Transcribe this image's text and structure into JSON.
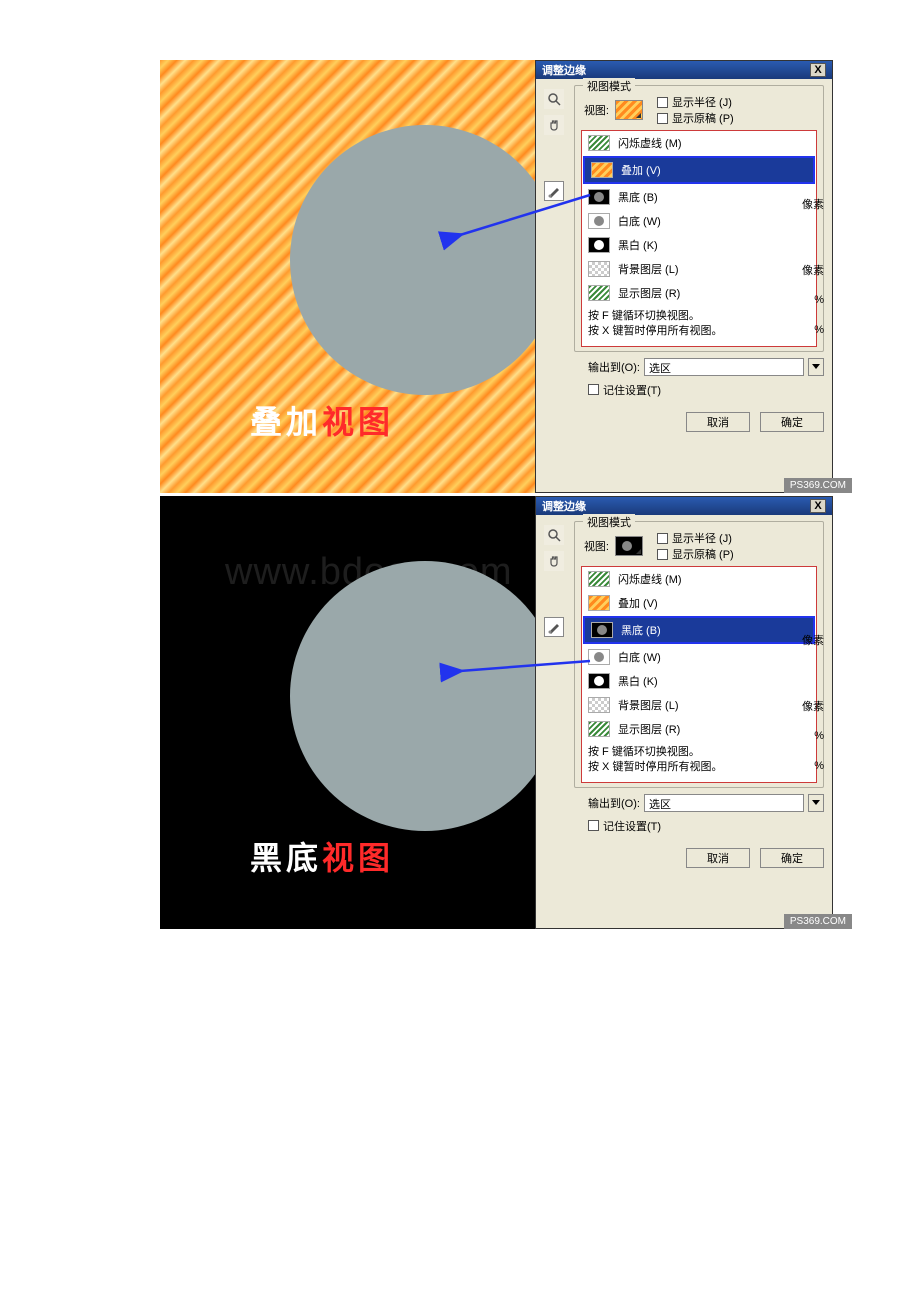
{
  "dialog_title": "调整边缘",
  "close_x": "X",
  "group_title": "视图模式",
  "view_label": "视图:",
  "checkboxes": {
    "show_radius": "显示半径 (J)",
    "show_original": "显示原稿 (P)"
  },
  "view_modes": [
    {
      "label": "闪烁虚线 (M)",
      "thumb": "th-ants"
    },
    {
      "label": "叠加 (V)",
      "thumb": "th-ov"
    },
    {
      "label": "黑底 (B)",
      "thumb": "th-blk"
    },
    {
      "label": "白底 (W)",
      "thumb": "th-wht"
    },
    {
      "label": "黑白 (K)",
      "thumb": "th-bw"
    },
    {
      "label": "背景图层 (L)",
      "thumb": "th-bg"
    },
    {
      "label": "显示图层 (R)",
      "thumb": "th-rev"
    }
  ],
  "hint1": "按 F 键循环切换视图。",
  "hint2": "按 X 键暂时停用所有视图。",
  "side_labels": {
    "pixels": "像素",
    "percent": "%"
  },
  "output_label": "输出到(O):",
  "output_value": "选区",
  "remember_label": "记住设置(T)",
  "cancel_btn": "取消",
  "ok_btn": "确定",
  "brand": "PS369.COM",
  "watermark": "www.bdocx.com",
  "screenshots": [
    {
      "caption_a": "叠加",
      "caption_b": "视图",
      "bg": "overlay",
      "selected_idx": 1
    },
    {
      "caption_a": "黑底",
      "caption_b": "视图",
      "bg": "black",
      "selected_idx": 2
    }
  ]
}
